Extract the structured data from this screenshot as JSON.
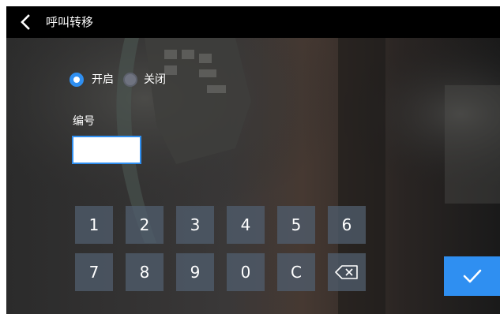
{
  "header": {
    "title": "呼叫转移",
    "back_icon": "chevron-left-icon"
  },
  "mode": {
    "options": [
      {
        "label": "开启",
        "selected": true
      },
      {
        "label": "关闭",
        "selected": false
      }
    ]
  },
  "number_field": {
    "label": "编号",
    "value": ""
  },
  "keypad": {
    "row1": [
      "1",
      "2",
      "3",
      "4",
      "5",
      "6"
    ],
    "row2": [
      "7",
      "8",
      "9",
      "0",
      "C"
    ],
    "backspace_icon": "backspace-icon"
  },
  "confirm_icon": "checkmark-icon",
  "colors": {
    "accent": "#2f8ff1",
    "titlebar": "#000000",
    "key_bg": "#505c6c"
  }
}
